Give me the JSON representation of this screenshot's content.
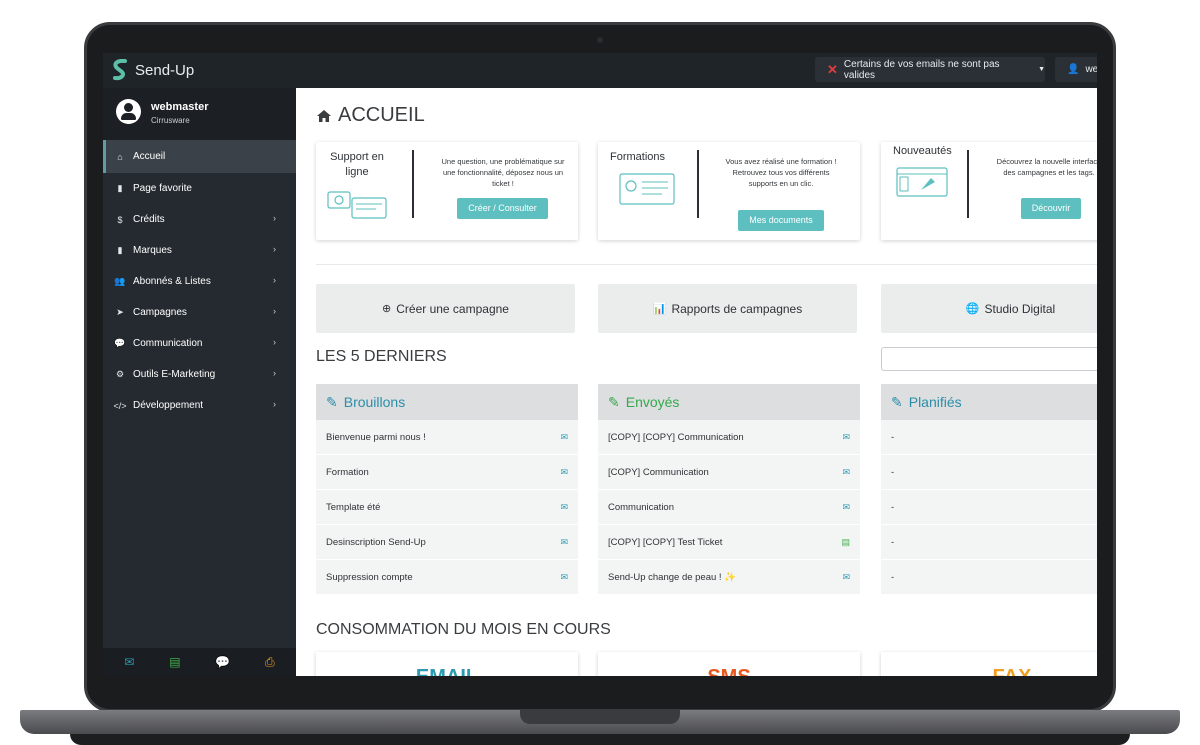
{
  "topbar": {
    "brand": "Send-Up",
    "alert": "Certains de vos emails ne sont pas valides",
    "user": "web"
  },
  "sidebar": {
    "profile": {
      "name": "webmaster",
      "company": "Cirrusware"
    },
    "items": [
      {
        "label": "Accueil",
        "icon": "home-icon",
        "active": true
      },
      {
        "label": "Page favorite",
        "icon": "bookmark-icon"
      },
      {
        "label": "Crédits",
        "icon": "dollar-icon"
      },
      {
        "label": "Marques",
        "icon": "bookmark-icon"
      },
      {
        "label": "Abonnés & Listes",
        "icon": "users-icon"
      },
      {
        "label": "Campagnes",
        "icon": "paper-plane-icon"
      },
      {
        "label": "Communication",
        "icon": "comments-icon"
      },
      {
        "label": "Outils E-Marketing",
        "icon": "gear-icon"
      },
      {
        "label": "Développement",
        "icon": "code-icon"
      }
    ],
    "footer_icons": [
      "envelope-icon",
      "document-icon",
      "comments-icon",
      "print-icon"
    ]
  },
  "main": {
    "title": "ACCUEIL",
    "cards": [
      {
        "title": "Support en ligne",
        "text": "Une question, une problématique sur une fonctionnalité, déposez nous un ticket !",
        "button": "Créer / Consulter"
      },
      {
        "title": "Formations",
        "text": "Vous avez réalisé une formation ! Retrouvez tous vos différents supports en un clic.",
        "button": "Mes documents"
      },
      {
        "title": "Nouveautés",
        "text": "Découvrez la nouvelle interface des campagnes et les tags.",
        "button": "Découvrir"
      }
    ],
    "actions": [
      {
        "label": "Créer une campagne",
        "icon": "plus-circle-icon"
      },
      {
        "label": "Rapports de campagnes",
        "icon": "bar-chart-icon"
      },
      {
        "label": "Studio Digital",
        "icon": "globe-icon"
      }
    ],
    "last_title": "LES 5 DERNIERS",
    "lists": [
      {
        "title": "Brouillons",
        "color": "#2c8ea8",
        "rows": [
          "Bienvenue parmi nous !",
          "Formation",
          "Template été",
          "Desinscription Send-Up",
          "Suppression compte"
        ]
      },
      {
        "title": "Envoyés",
        "color": "#36a84e",
        "rows": [
          "[COPY] [COPY] Communication",
          "[COPY] Communication",
          "Communication",
          "[COPY] [COPY] Test Ticket",
          "Send-Up change de peau ! ✨"
        ]
      },
      {
        "title": "Planifiés",
        "color": "#2c8ea8",
        "rows": [
          "-",
          "-",
          "-",
          "-",
          "-"
        ]
      }
    ],
    "consumption_title": "CONSOMMATION DU MOIS EN COURS",
    "consumption": [
      {
        "label": "EMAIL",
        "color": "#2c9ab0"
      },
      {
        "label": "SMS",
        "color": "#e8571e"
      },
      {
        "label": "FAX",
        "color": "#f0a020"
      }
    ]
  }
}
